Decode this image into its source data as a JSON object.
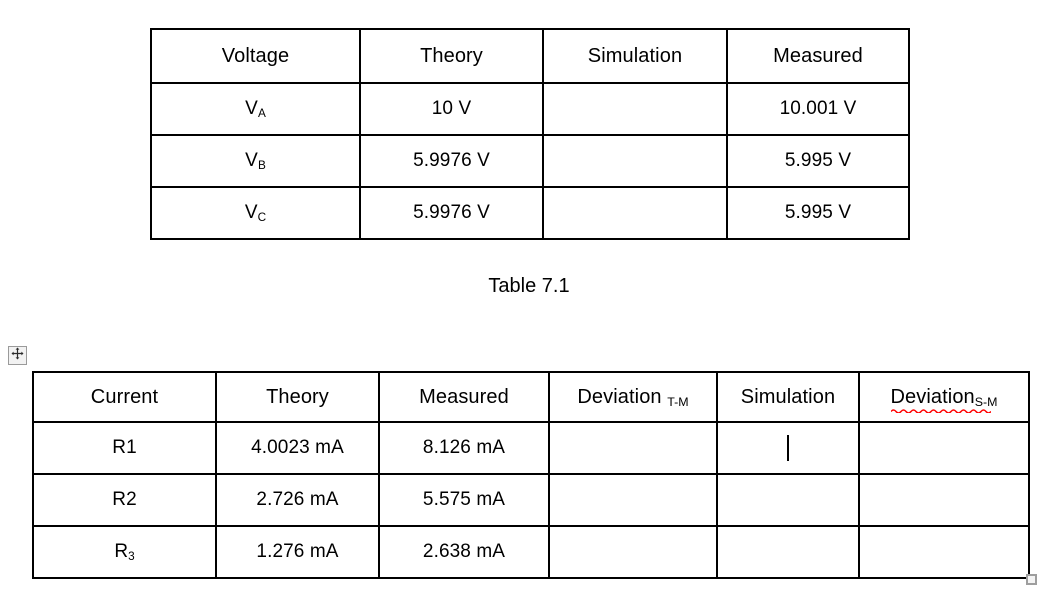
{
  "document": {
    "caption": "Table 7.1"
  },
  "voltage_table": {
    "name": "Table 7.1",
    "headers": [
      "Voltage",
      "Theory",
      "Simulation",
      "Measured"
    ],
    "rows": [
      {
        "label": "V",
        "label_sub": "A",
        "theory": "10 V",
        "simulation": "",
        "measured": "10.001 V"
      },
      {
        "label": "V",
        "label_sub": "B",
        "theory": "5.9976 V",
        "simulation": "",
        "measured": "5.995 V"
      },
      {
        "label": "V",
        "label_sub": "C",
        "theory": "5.9976 V",
        "simulation": "",
        "measured": "5.995 V"
      }
    ]
  },
  "current_table": {
    "headers": [
      {
        "text": "Current",
        "sub": ""
      },
      {
        "text": "Theory",
        "sub": ""
      },
      {
        "text": "Measured",
        "sub": ""
      },
      {
        "text": "Deviation ",
        "sub": "T-M"
      },
      {
        "text": "Simulation",
        "sub": ""
      },
      {
        "text": "Deviation",
        "sub": "S-M"
      }
    ],
    "rows": [
      {
        "label": "R1",
        "label_sub": "",
        "theory": "4.0023 mA",
        "measured": "8.126 mA",
        "deviation_tm": "",
        "simulation": "",
        "deviation_sm": ""
      },
      {
        "label": "R2",
        "label_sub": "",
        "theory": "2.726 mA",
        "measured": "5.575 mA",
        "deviation_tm": "",
        "simulation": "",
        "deviation_sm": ""
      },
      {
        "label": "R",
        "label_sub": "3",
        "theory": "1.276 mA",
        "measured": "2.638 mA",
        "deviation_tm": "",
        "simulation": "",
        "deviation_sm": ""
      }
    ]
  },
  "handles": {
    "move_icon": "move-four-arrows-icon",
    "resize_icon": "table-resize-handle-icon"
  },
  "colors": {
    "border": "#000000",
    "text": "#000000",
    "background": "#ffffff",
    "spellcheck": "#ff0000",
    "handle_border": "#9a9a9a",
    "handle_fill": "#f2f2f2"
  }
}
